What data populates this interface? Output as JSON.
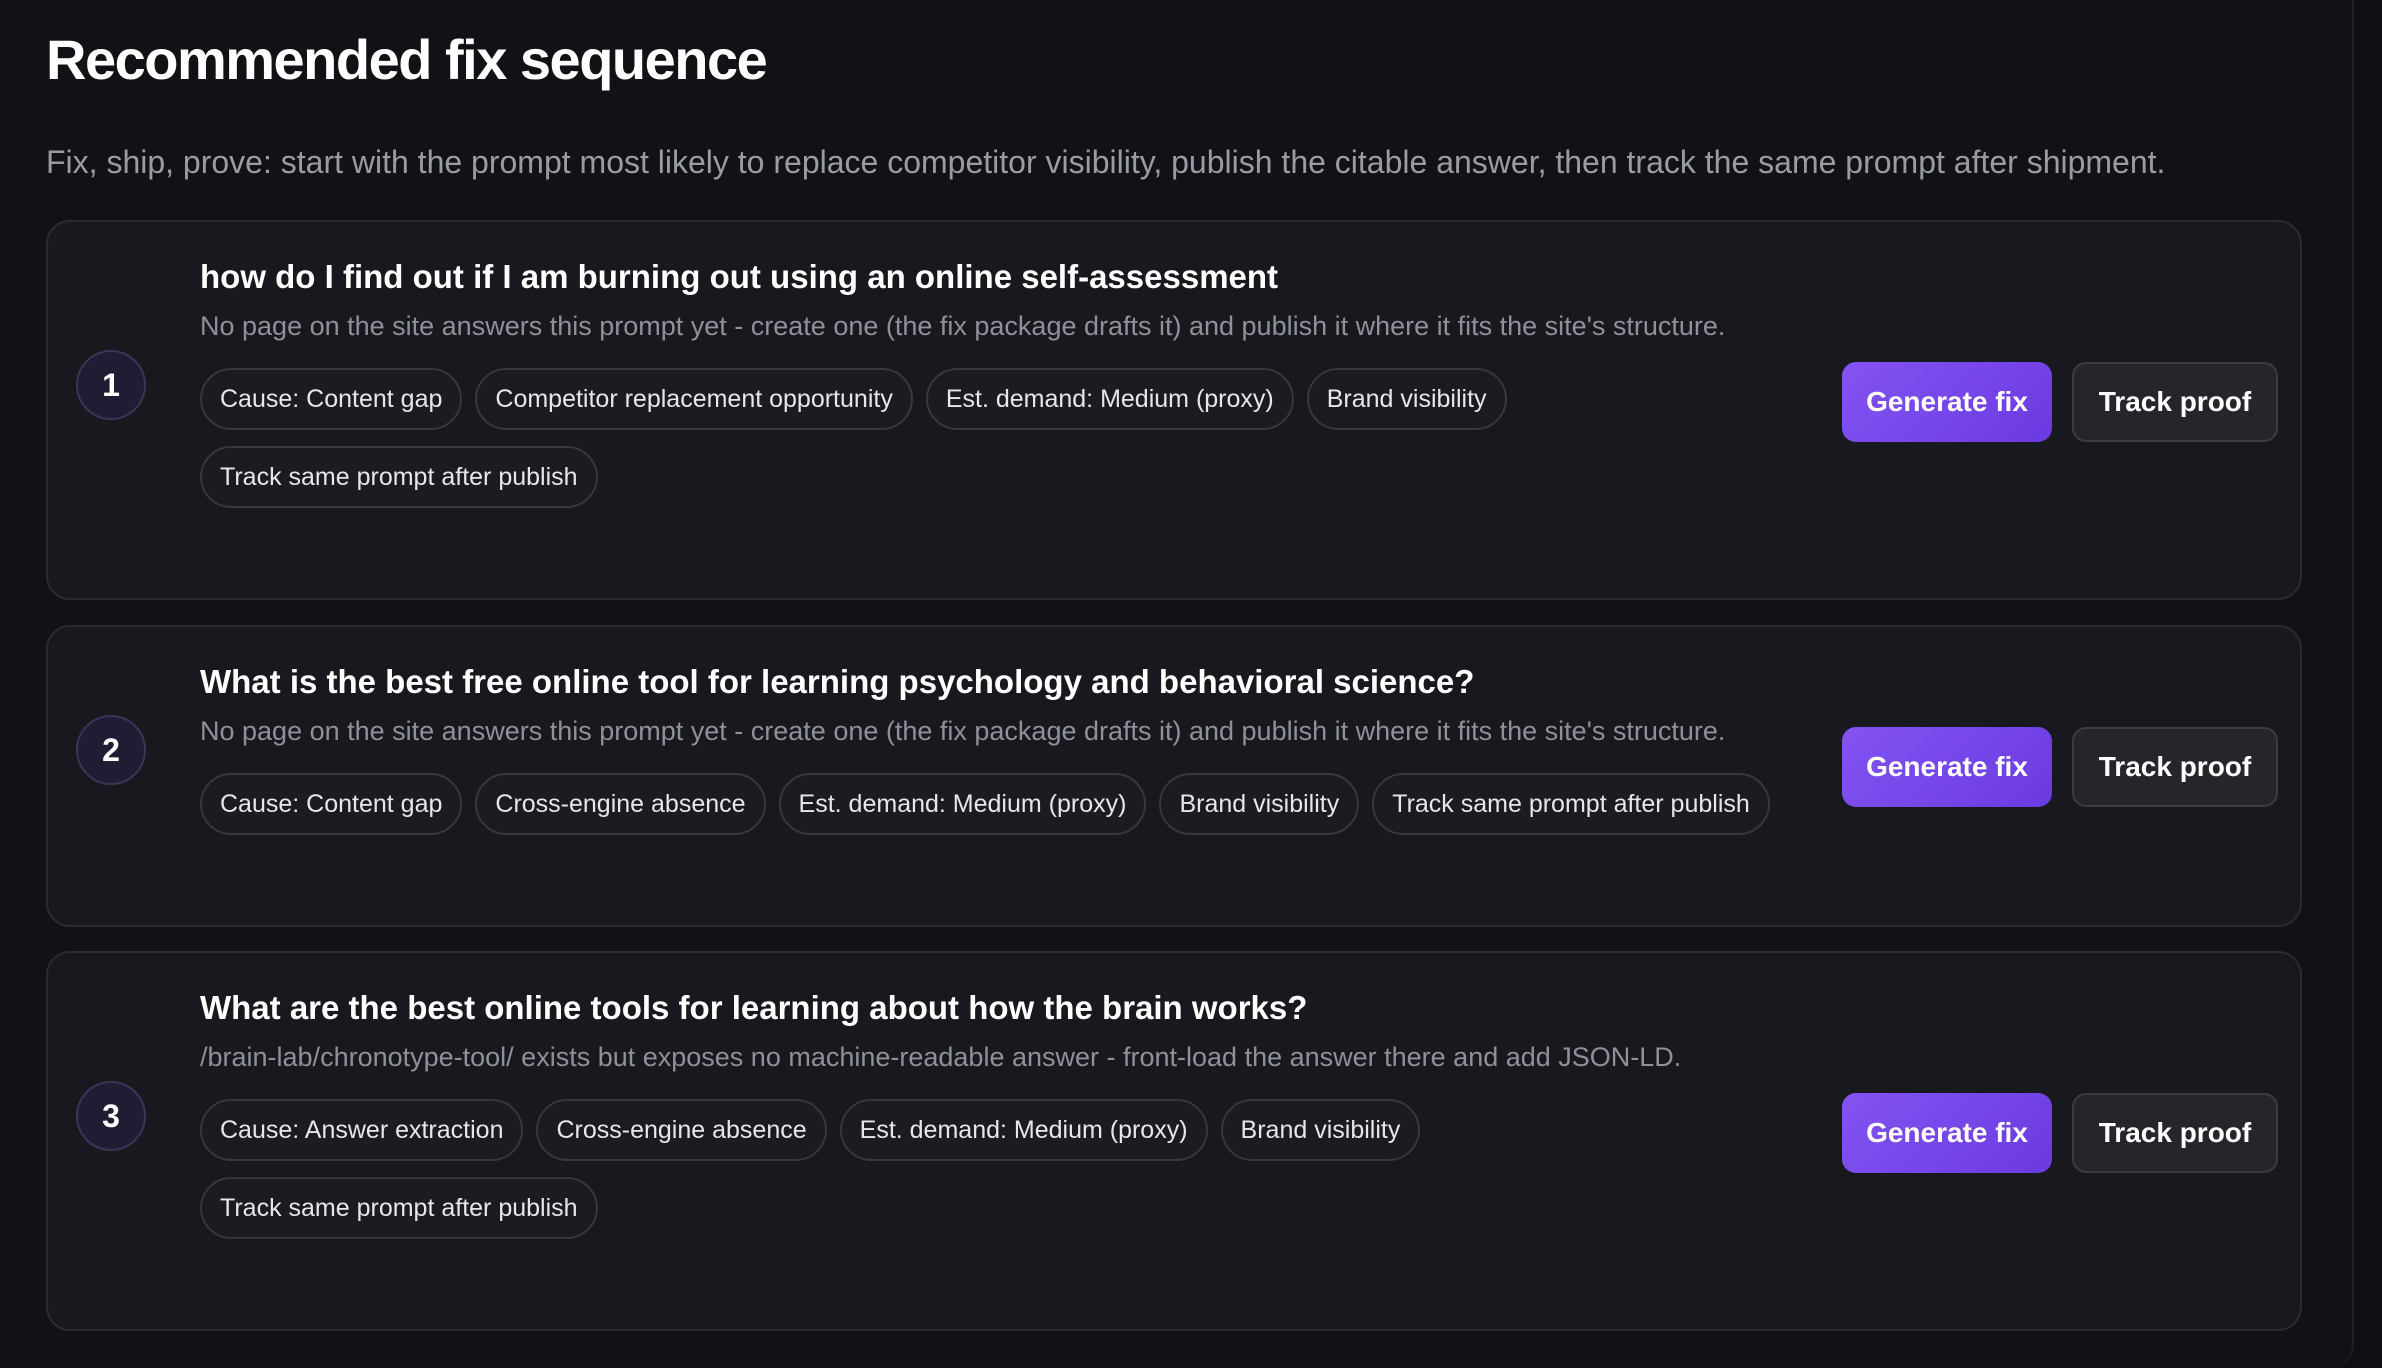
{
  "header": {
    "title": "Recommended fix sequence",
    "subtitle": "Fix, ship, prove: start with the prompt most likely to replace competitor visibility, publish the citable answer, then track the same prompt after shipment."
  },
  "colors": {
    "accent": "#7c4ef0",
    "background": "#111216",
    "card": "#18191e"
  },
  "steps": [
    {
      "number": "1",
      "prompt": "how do I find out if I am burning out using an online self-assessment",
      "description": "No page on the site answers this prompt yet - create one (the fix package drafts it) and publish it where it fits the site's structure.",
      "chips": [
        "Cause: Content gap",
        "Competitor replacement opportunity",
        "Est. demand: Medium (proxy)",
        "Brand visibility",
        "Track same prompt after publish"
      ],
      "primary_action": "Generate fix",
      "secondary_action": "Track proof"
    },
    {
      "number": "2",
      "prompt": "What is the best free online tool for learning psychology and behavioral science?",
      "description": "No page on the site answers this prompt yet - create one (the fix package drafts it) and publish it where it fits the site's structure.",
      "chips": [
        "Cause: Content gap",
        "Cross-engine absence",
        "Est. demand: Medium (proxy)",
        "Brand visibility",
        "Track same prompt after publish"
      ],
      "primary_action": "Generate fix",
      "secondary_action": "Track proof"
    },
    {
      "number": "3",
      "prompt": "What are the best online tools for learning about how the brain works?",
      "description": "/brain-lab/chronotype-tool/ exists but exposes no machine-readable answer - front-load the answer there and add JSON-LD.",
      "chips": [
        "Cause: Answer extraction",
        "Cross-engine absence",
        "Est. demand: Medium (proxy)",
        "Brand visibility",
        "Track same prompt after publish"
      ],
      "primary_action": "Generate fix",
      "secondary_action": "Track proof"
    }
  ]
}
